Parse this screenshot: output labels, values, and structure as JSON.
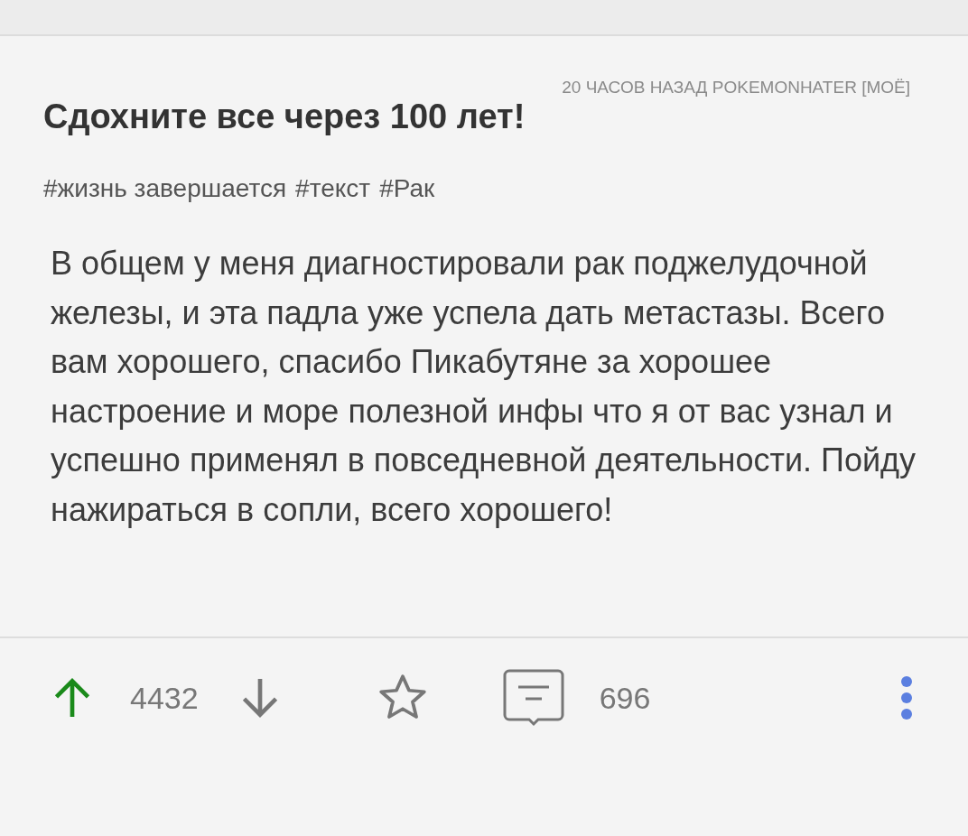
{
  "post": {
    "meta": "20 ЧАСОВ НАЗАД  POKEMONHATER [МОЁ]",
    "title": "Сдохните все через 100 лет!",
    "tags": [
      "#жизнь завершается",
      "#текст",
      "#Рак"
    ],
    "body": "В общем у меня диагностировали рак поджелудочной железы, и эта падла уже успела дать метастазы. Всего вам хорошего, спасибо Пикабутяне за хорошее настроение и море полезной инфы что я от вас узнал и успешно применял в повседневной деятельности. Пойду нажираться в сопли, всего хорошего!"
  },
  "actions": {
    "upvote_selected": true,
    "rating": "4432",
    "downvote_selected": false,
    "saved": false,
    "comments": "696"
  }
}
